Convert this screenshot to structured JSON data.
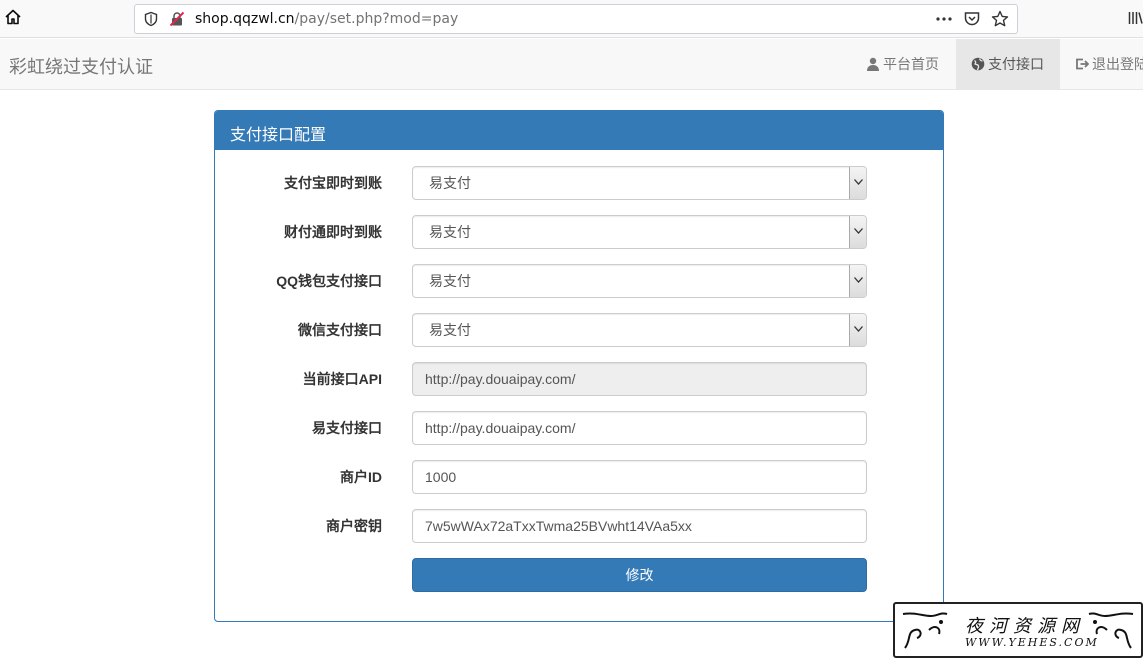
{
  "browser": {
    "url_host": "shop.qqzwl.cn",
    "url_path": "/pay/set.php?mod=pay"
  },
  "navbar": {
    "brand": "彩虹绕过支付认证",
    "items": [
      {
        "label": "平台首页",
        "icon": "user-icon"
      },
      {
        "label": "支付接口",
        "icon": "globe-icon",
        "active": true
      },
      {
        "label": "退出登陆",
        "icon": "logout-icon"
      }
    ]
  },
  "panel": {
    "title": "支付接口配置",
    "fields": [
      {
        "label": "支付宝即时到账",
        "type": "select",
        "value": "易支付"
      },
      {
        "label": "财付通即时到账",
        "type": "select",
        "value": "易支付"
      },
      {
        "label": "QQ钱包支付接口",
        "type": "select",
        "value": "易支付"
      },
      {
        "label": "微信支付接口",
        "type": "select",
        "value": "易支付"
      },
      {
        "label": "当前接口API",
        "type": "readonly",
        "value": "http://pay.douaipay.com/"
      },
      {
        "label": "易支付接口",
        "type": "input",
        "value": "http://pay.douaipay.com/"
      },
      {
        "label": "商户ID",
        "type": "input",
        "value": "1000"
      },
      {
        "label": "商户密钥",
        "type": "input",
        "value": "7w5wWAx72aTxxTwma25BVwht14VAa5xx"
      }
    ],
    "submit_label": "修改"
  },
  "watermark": {
    "title": "夜河资源网",
    "url": "WWW.YEHES.COM"
  },
  "colors": {
    "primary": "#337ab7",
    "navbar_bg": "#f8f8f8",
    "active_nav_bg": "#e7e7e7"
  }
}
